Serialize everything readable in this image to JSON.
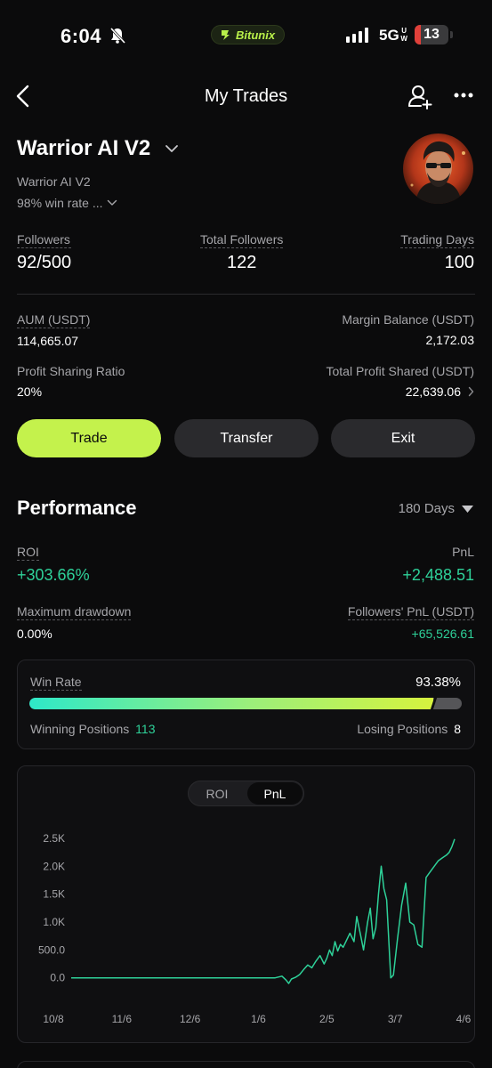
{
  "status_bar": {
    "time": "6:04",
    "brand": "Bitunix",
    "network": "5G",
    "network_sup": "UW",
    "battery": "13"
  },
  "header": {
    "title": "My Trades"
  },
  "profile": {
    "name": "Warrior AI V2",
    "subtitle": "Warrior AI V2",
    "description": "98% win rate ..."
  },
  "stats_row1": [
    {
      "label": "Followers",
      "value": "92/500"
    },
    {
      "label": "Total Followers",
      "value": "122"
    },
    {
      "label": "Trading Days",
      "value": "100"
    }
  ],
  "stats_row2": [
    {
      "label": "AUM (USDT)",
      "value": "114,665.07"
    },
    {
      "label": "Margin Balance (USDT)",
      "value": "2,172.03"
    }
  ],
  "stats_row3": [
    {
      "label": "Profit Sharing Ratio",
      "value": "20%"
    },
    {
      "label": "Total Profit Shared (USDT)",
      "value": "22,639.06"
    }
  ],
  "actions": {
    "trade": "Trade",
    "transfer": "Transfer",
    "exit": "Exit"
  },
  "performance": {
    "title": "Performance",
    "period": "180 Days",
    "roi_label": "ROI",
    "roi_value": "+303.66%",
    "pnl_label": "PnL",
    "pnl_value": "+2,488.51",
    "mdd_label": "Maximum drawdown",
    "mdd_value": "0.00%",
    "fpnl_label": "Followers' PnL (USDT)",
    "fpnl_value": "+65,526.61"
  },
  "win_rate": {
    "label": "Win Rate",
    "value": "93.38%",
    "fraction": 0.9338,
    "winning_label": "Winning Positions",
    "winning_value": "113",
    "losing_label": "Losing Positions",
    "losing_value": "8"
  },
  "chart_toggle": {
    "roi": "ROI",
    "pnl": "PnL",
    "selected": "PnL"
  },
  "colors": {
    "accent": "#c4f24c",
    "positive": "#2ed199",
    "line": "#2ed199"
  },
  "chart_data": {
    "type": "line",
    "ylim": [
      -100,
      2500
    ],
    "yticks": [
      "2.5K",
      "2.0K",
      "1.5K",
      "1.0K",
      "500.0",
      "0.0"
    ],
    "ytick_values": [
      2500,
      2000,
      1500,
      1000,
      500,
      0
    ],
    "xticks": [
      "10/8",
      "11/6",
      "12/6",
      "1/6",
      "2/5",
      "3/7",
      "4/6"
    ],
    "series": [
      {
        "x": [
          0,
          40,
          80,
          120,
          150,
          155,
          158,
          160,
          162,
          165,
          168,
          171,
          174,
          177,
          180,
          183,
          186,
          188,
          190,
          192,
          194,
          196,
          198,
          200,
          203,
          205,
          208,
          210,
          213,
          215,
          218,
          220,
          222,
          224,
          226,
          228,
          230,
          232,
          235,
          237,
          240,
          243,
          246,
          249,
          252,
          255,
          258,
          261,
          264,
          267,
          270,
          273,
          276,
          278,
          279,
          280,
          281,
          282
        ],
        "y": [
          0,
          0,
          0,
          0,
          0,
          30,
          -40,
          -100,
          -20,
          10,
          60,
          150,
          230,
          180,
          300,
          400,
          250,
          350,
          500,
          400,
          650,
          480,
          600,
          550,
          700,
          800,
          650,
          1100,
          750,
          500,
          1000,
          1250,
          700,
          900,
          1500,
          2000,
          1600,
          1400,
          0,
          50,
          700,
          1300,
          1700,
          1000,
          950,
          600,
          550,
          1800,
          1900,
          2000,
          2100,
          2150,
          2200,
          2250,
          2300,
          2350,
          2420,
          2488
        ]
      }
    ]
  }
}
